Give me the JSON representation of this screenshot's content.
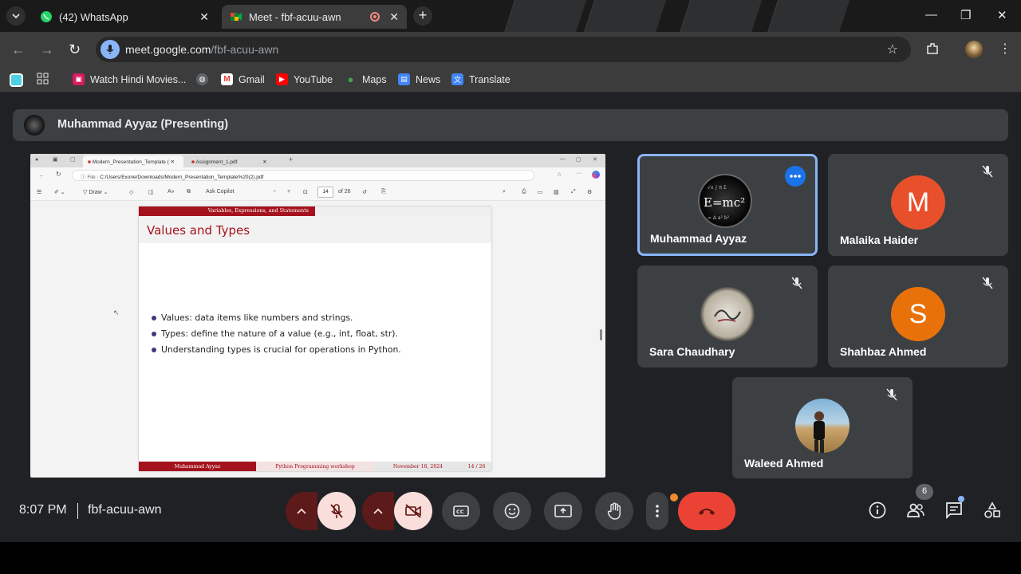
{
  "browser": {
    "tabs": [
      {
        "title": "(42) WhatsApp",
        "active": false
      },
      {
        "title": "Meet - fbf-acuu-awn",
        "active": true
      }
    ],
    "url_host": "meet.google.com",
    "url_path": "/fbf-acuu-awn",
    "bookmarks": [
      {
        "label": "Watch Hindi Movies...",
        "icon": "movie-icon",
        "color": "#d81b60"
      },
      {
        "label": "",
        "icon": "globe-icon",
        "color": "#9aa0a6"
      },
      {
        "label": "Gmail",
        "icon": "gmail-icon",
        "color": "#ea4335"
      },
      {
        "label": "YouTube",
        "icon": "youtube-icon",
        "color": "#ff0000"
      },
      {
        "label": "Maps",
        "icon": "maps-icon",
        "color": "#34a853"
      },
      {
        "label": "News",
        "icon": "news-icon",
        "color": "#4285f4"
      },
      {
        "label": "Translate",
        "icon": "translate-icon",
        "color": "#4285f4"
      }
    ]
  },
  "meet": {
    "presenting_label": "Muhammad Ayyaz (Presenting)",
    "shared_screen": {
      "tabs": [
        "Modern_Presentation_Template (",
        "Assignment_1.pdf"
      ],
      "address_prefix": "File",
      "address": "C:/Users/Exone/Downloads/Modern_Presentation_Template%20(2).pdf",
      "toolbar": {
        "draw": "Draw",
        "ask_copilot": "Ask Copilot",
        "page_current": "14",
        "page_total": "of 26",
        "minus": "−",
        "plus": "+"
      },
      "slide": {
        "section": "Variables, Expressions, and Statements",
        "title": "Values and Types",
        "bullets": [
          "Values: data items like numbers and strings.",
          "Types: define the nature of a value (e.g., int, float, str).",
          "Understanding types is crucial for operations in Python."
        ],
        "footer": {
          "author": "Muhammad Ayyaz",
          "event": "Python Programming workshop",
          "date": "November 18, 2024",
          "page": "14 / 26"
        }
      }
    },
    "participants": [
      {
        "name": "Muhammad Ayyaz",
        "initial": "",
        "avatar": "photo-emc2",
        "muted": false,
        "speaking": true
      },
      {
        "name": "Malaika Haider",
        "initial": "M",
        "avatar_color": "#e8502c",
        "muted": true
      },
      {
        "name": "Sara Chaudhary",
        "initial": "",
        "avatar": "photo-calligraphy",
        "muted": true
      },
      {
        "name": "Shahbaz Ahmed",
        "initial": "S",
        "avatar_color": "#e8710a",
        "muted": true
      },
      {
        "name": "Waleed Ahmed",
        "initial": "",
        "avatar": "photo-person",
        "muted": true
      }
    ],
    "controls": {
      "time": "8:07 PM",
      "meeting_code": "fbf-acuu-awn",
      "people_count": "6"
    }
  },
  "colors": {
    "accent": "#8ab4f8",
    "end_call": "#ea4335",
    "slide_red": "#a4121d"
  }
}
